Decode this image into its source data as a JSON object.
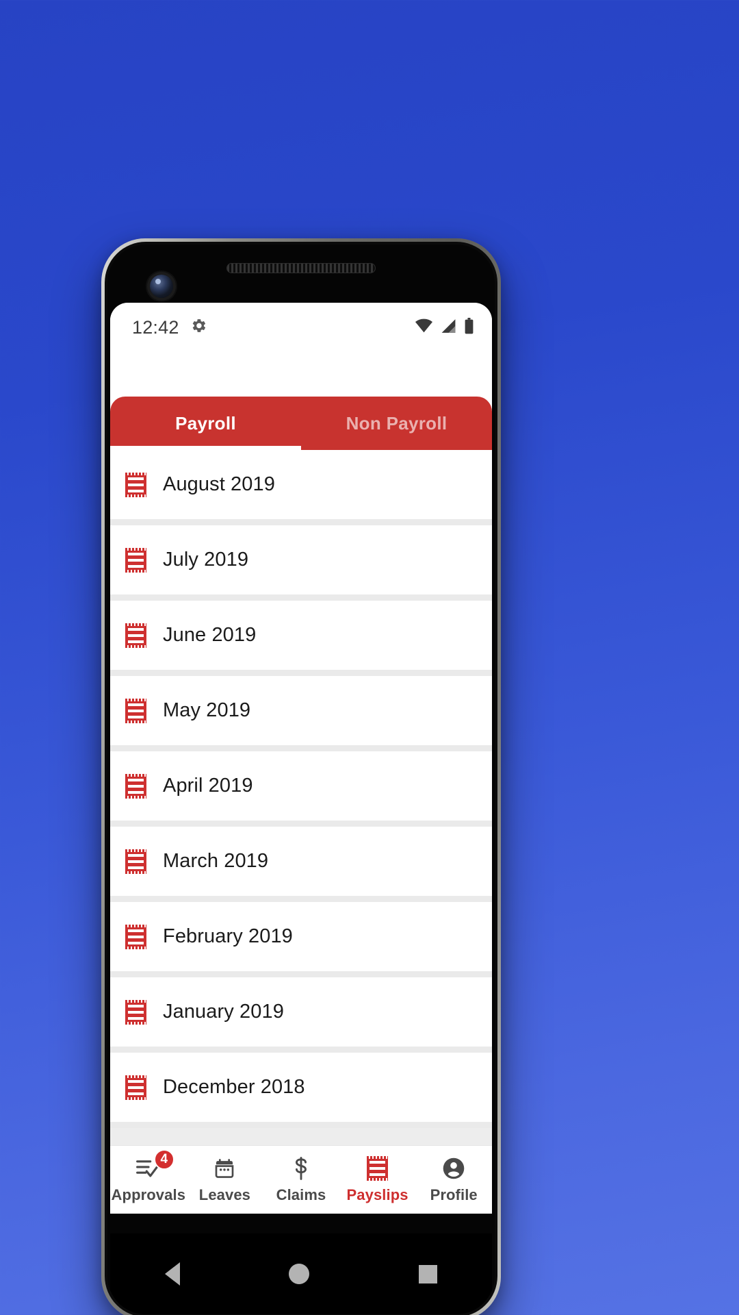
{
  "statusbar": {
    "time": "12:42",
    "left_icons": [
      "settings-gear-icon"
    ],
    "right_icons": [
      "wifi-icon",
      "cellular-signal-icon",
      "battery-icon"
    ]
  },
  "tabs": [
    {
      "label": "Payroll",
      "active": true
    },
    {
      "label": "Non Payroll",
      "active": false
    }
  ],
  "payslips": [
    {
      "label": "August 2019",
      "icon": "receipt-icon"
    },
    {
      "label": "July 2019",
      "icon": "receipt-icon"
    },
    {
      "label": "June 2019",
      "icon": "receipt-icon"
    },
    {
      "label": "May 2019",
      "icon": "receipt-icon"
    },
    {
      "label": "April 2019",
      "icon": "receipt-icon"
    },
    {
      "label": "March 2019",
      "icon": "receipt-icon"
    },
    {
      "label": "February 2019",
      "icon": "receipt-icon"
    },
    {
      "label": "January 2019",
      "icon": "receipt-icon"
    },
    {
      "label": "December 2018",
      "icon": "receipt-icon"
    }
  ],
  "bottom_nav": [
    {
      "label": "Approvals",
      "icon": "checklist-icon",
      "badge": "4",
      "active": false
    },
    {
      "label": "Leaves",
      "icon": "calendar-icon",
      "badge": "",
      "active": false
    },
    {
      "label": "Claims",
      "icon": "dollar-icon",
      "badge": "",
      "active": false
    },
    {
      "label": "Payslips",
      "icon": "receipt-icon",
      "badge": "",
      "active": true
    },
    {
      "label": "Profile",
      "icon": "person-circle-icon",
      "badge": "",
      "active": false
    }
  ],
  "android_nav": {
    "back": "back-triangle-icon",
    "home": "home-circle-icon",
    "recents": "recents-square-icon"
  },
  "colors": {
    "brand_red": "#c8332f",
    "accent_red": "#ce2f2f",
    "background_blue": "#2a48cb",
    "separator": "#eaeaea"
  }
}
